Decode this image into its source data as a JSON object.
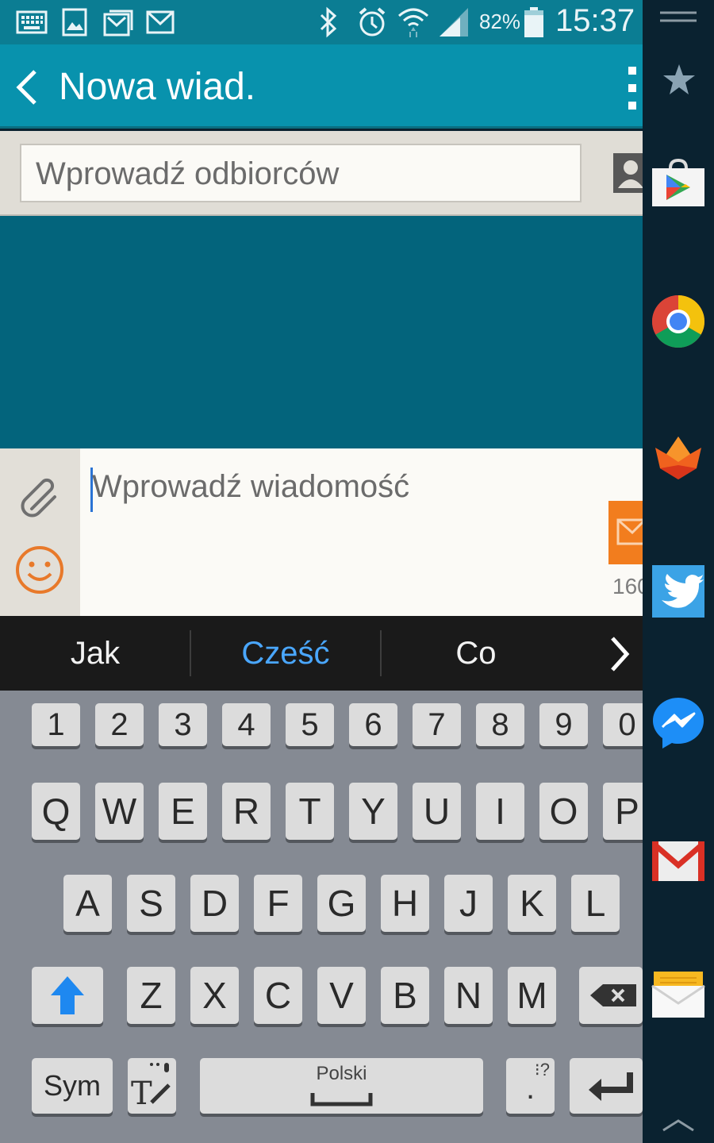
{
  "status_bar": {
    "notification_icons": [
      "keyboard-icon",
      "image-icon",
      "gallery-icon",
      "gmail-icon"
    ],
    "system_icons": [
      "bluetooth-icon",
      "alarm-icon",
      "wifi-icon",
      "signal-icon"
    ],
    "battery_percent": "82%",
    "battery_level": 0.82,
    "time": "15:37"
  },
  "action_bar": {
    "back_icon": "chevron-left-icon",
    "title": "Nowa wiad.",
    "menu_icon": "overflow-menu-icon"
  },
  "recipients": {
    "placeholder": "Wprowadź odbiorców",
    "contact_icon": "contact-icon"
  },
  "composer": {
    "attach_icon": "paperclip-icon",
    "emoji_icon": "smiley-icon",
    "placeholder": "Wprowadź wiadomość",
    "send_icon": "send-icon",
    "char_count": "160"
  },
  "suggestions": {
    "items": [
      "Jak",
      "Cześć",
      "Co"
    ],
    "highlighted": "Cześć",
    "highlight_color": "#4aa7ff",
    "next_icon": "chevron-right-icon"
  },
  "keyboard": {
    "number_row": [
      "1",
      "2",
      "3",
      "4",
      "5",
      "6",
      "7",
      "8",
      "9",
      "0"
    ],
    "row1": [
      "Q",
      "W",
      "E",
      "R",
      "T",
      "Y",
      "U",
      "I",
      "O",
      "P"
    ],
    "row2": [
      "A",
      "S",
      "D",
      "F",
      "G",
      "H",
      "J",
      "K",
      "L"
    ],
    "row3": [
      "Z",
      "X",
      "C",
      "V",
      "B",
      "N",
      "M"
    ],
    "shift_icon": "shift-arrow-icon",
    "backspace_icon": "backspace-icon",
    "sym_label": "Sym",
    "handwriting_icon": "handwriting-icon",
    "space_label": "Polski",
    "punct_key": "⁝?",
    "period_label": ".",
    "enter_icon": "enter-icon",
    "shift_color": "#1e88f0"
  },
  "edge_panel": {
    "handle_icon": "drag-handle-icon",
    "favorites_icon": "star-icon",
    "apps": [
      "play-store-icon",
      "chrome-icon",
      "fox-app-icon",
      "twitter-icon",
      "messenger-icon",
      "gmail-app-icon",
      "email-app-icon"
    ],
    "collapse_icon": "chevron-up-icon"
  }
}
